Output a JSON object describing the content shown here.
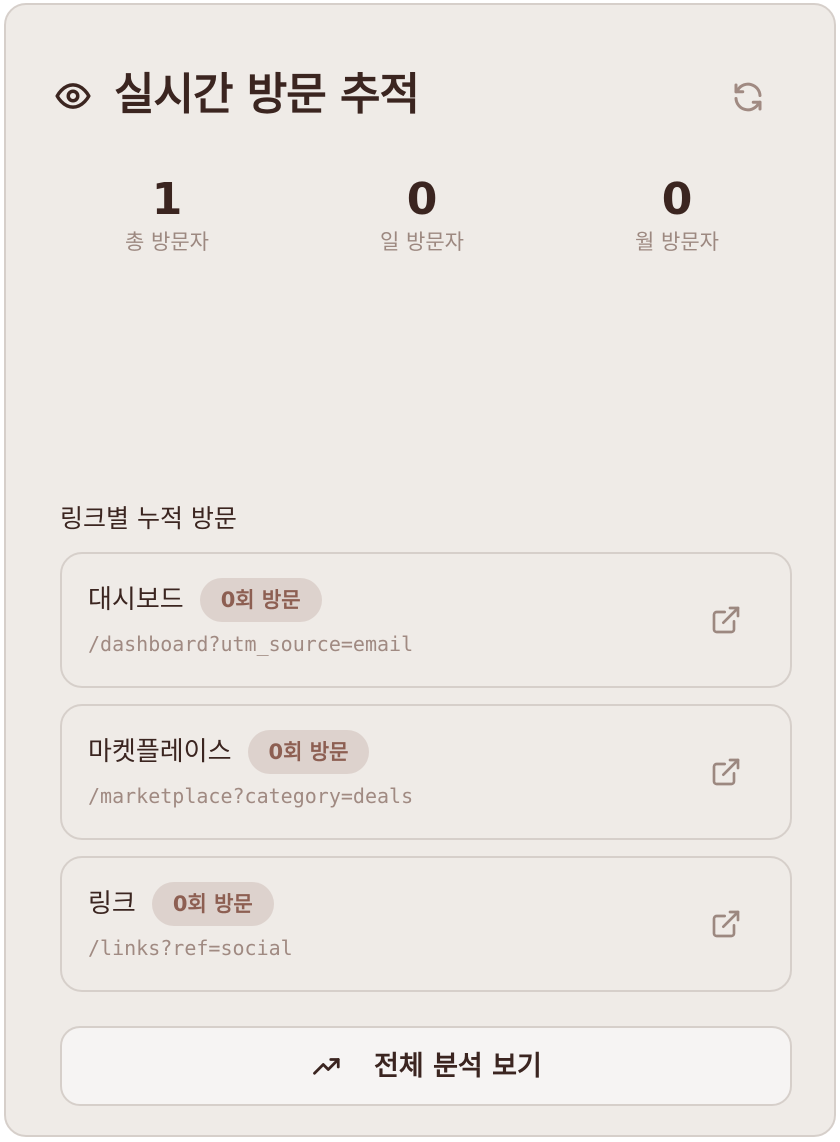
{
  "header": {
    "title": "실시간 방문 추적",
    "icon": "eye-icon",
    "refresh_icon": "refresh-icon"
  },
  "stats": [
    {
      "value": "1",
      "label": "총 방문자"
    },
    {
      "value": "0",
      "label": "일 방문자"
    },
    {
      "value": "0",
      "label": "월 방문자"
    }
  ],
  "links_section": {
    "title": "링크별 누적 방문",
    "items": [
      {
        "name": "대시보드",
        "badge": "0회 방문",
        "url": "/dashboard?utm_source=email",
        "icon": "external-link-icon"
      },
      {
        "name": "마켓플레이스",
        "badge": "0회 방문",
        "url": "/marketplace?category=deals",
        "icon": "external-link-icon"
      },
      {
        "name": "링크",
        "badge": "0회 방문",
        "url": "/links?ref=social",
        "icon": "external-link-icon"
      }
    ]
  },
  "footer": {
    "button_label": "전체 분석 보기",
    "button_icon": "trending-up-icon"
  },
  "colors": {
    "background": "#efebe7",
    "border": "#d6cfca",
    "text_primary": "#3b2520",
    "text_muted": "#9c8880",
    "badge_bg": "#ddd2cd",
    "badge_text": "#8d5f52"
  }
}
